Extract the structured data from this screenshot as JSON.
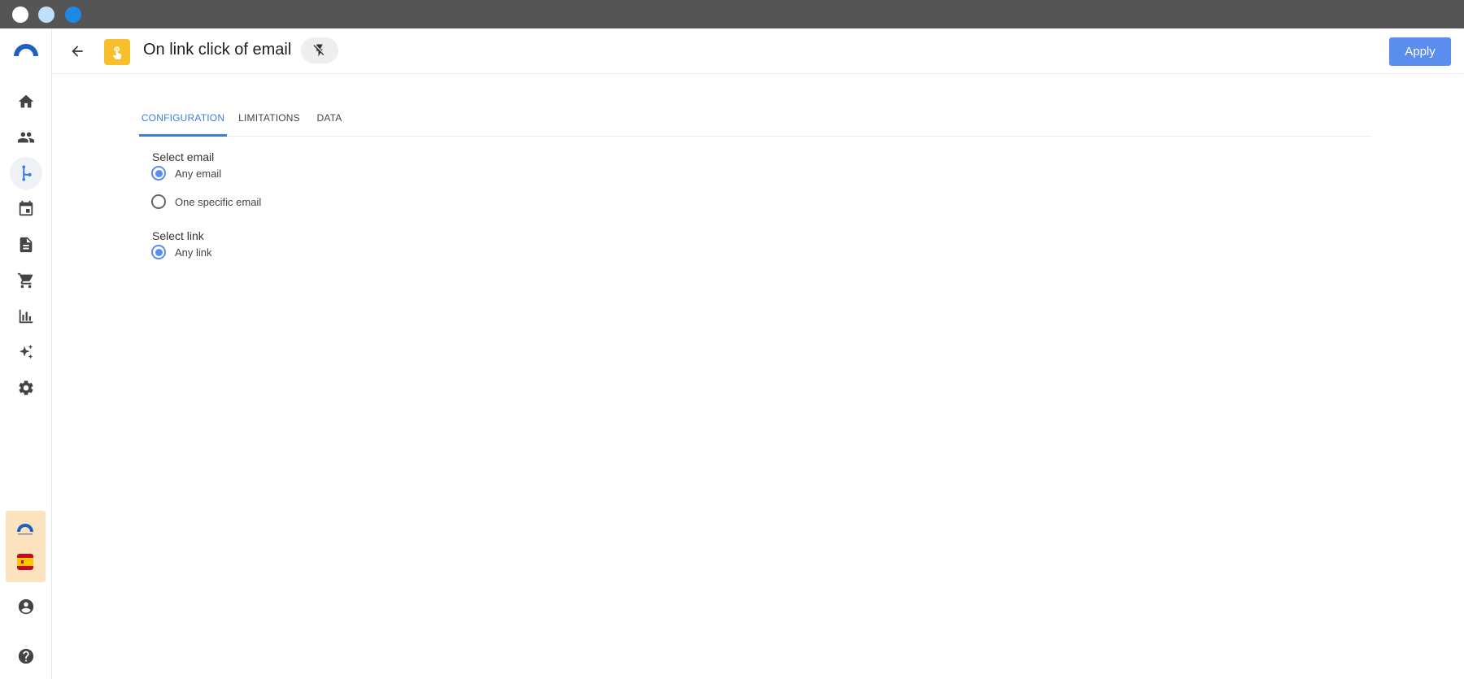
{
  "window": {
    "dots": [
      {
        "name": "close",
        "color": "#ffffff"
      },
      {
        "name": "minimize",
        "color": "#bfe0fb"
      },
      {
        "name": "maximize",
        "color": "#1e88e5"
      }
    ]
  },
  "colors": {
    "accent": "#5b8def",
    "tab_active": "#3b7ddd",
    "trigger": "#f6bf2b",
    "brand_box": "#fbe3c0"
  },
  "sidebar": {
    "items": [
      {
        "icon": "home-icon"
      },
      {
        "icon": "people-icon"
      },
      {
        "icon": "workflow-icon",
        "active": true
      },
      {
        "icon": "calendar-icon"
      },
      {
        "icon": "document-icon"
      },
      {
        "icon": "cart-icon"
      },
      {
        "icon": "bar-chart-icon"
      },
      {
        "icon": "sparkles-icon"
      },
      {
        "icon": "gear-icon"
      }
    ],
    "bottom": [
      {
        "icon": "account-icon"
      },
      {
        "icon": "help-icon"
      }
    ]
  },
  "header": {
    "title": "On link click of email",
    "apply_label": "Apply",
    "trigger_icon": "pointer-click-icon",
    "toggle_icon": "flash-off-icon"
  },
  "tabs": [
    {
      "label": "CONFIGURATION",
      "active": true
    },
    {
      "label": "LIMITATIONS",
      "active": false
    },
    {
      "label": "DATA",
      "active": false
    }
  ],
  "form": {
    "email_label": "Select email",
    "email_options": [
      {
        "label": "Any email",
        "checked": true
      },
      {
        "label": "One specific email",
        "checked": false
      }
    ],
    "link_label": "Select link",
    "link_options": [
      {
        "label": "Any link",
        "checked": true
      }
    ]
  }
}
